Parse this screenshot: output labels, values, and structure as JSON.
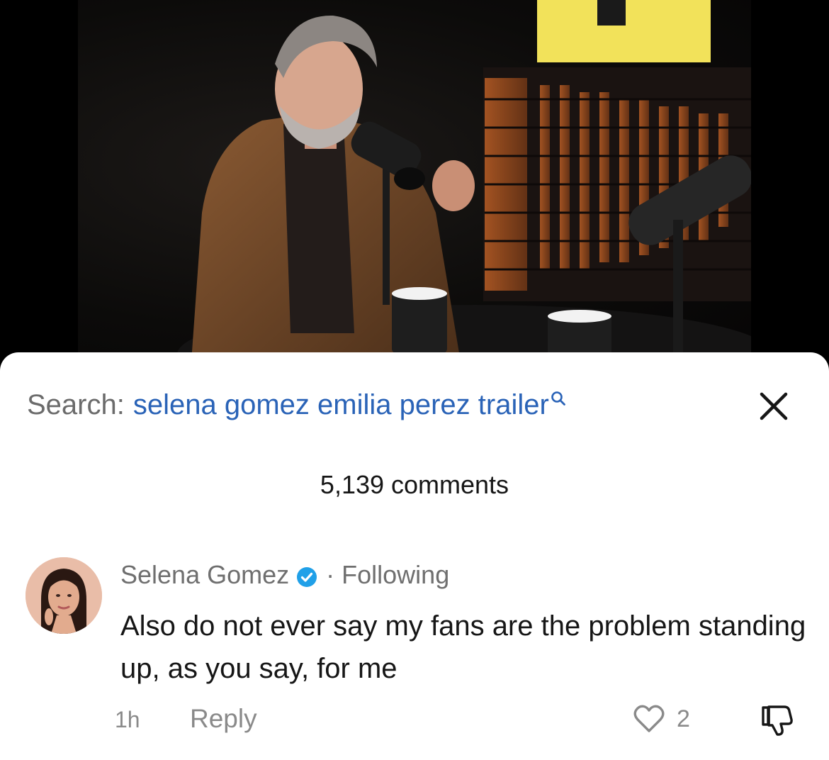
{
  "search": {
    "label": "Search:",
    "query": "selena gomez emilia perez trailer"
  },
  "comments": {
    "count_label": "5,139 comments"
  },
  "comment": {
    "author": "Selena Gomez",
    "separator": "·",
    "follow_status": "Following",
    "text": "Also do not ever say my fans are the problem standing up, as you say, for me",
    "time": "1h",
    "reply_label": "Reply",
    "like_count": "2"
  },
  "colors": {
    "search_query": "#2a63b7",
    "verified_badge": "#20a0e8",
    "secondary_text": "#8a8a8a"
  },
  "icons": {
    "search_query_icon": "search-icon",
    "close": "close-icon",
    "verified": "verified-badge-icon",
    "like": "heart-icon",
    "dislike": "thumbs-down-icon"
  }
}
